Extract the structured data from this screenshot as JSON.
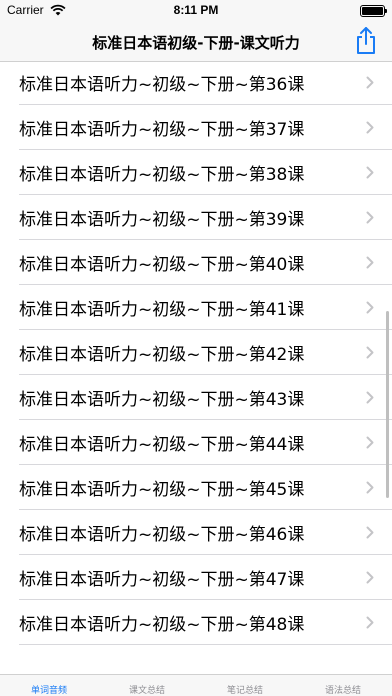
{
  "status_bar": {
    "carrier": "Carrier",
    "time": "8:11 PM",
    "battery_level": 1.0
  },
  "nav": {
    "title": "标准日本语初级-下册-课文听力",
    "share_icon": "share-icon",
    "accent_color": "#1a7cf5"
  },
  "list": {
    "items": [
      {
        "label": "标准日本语听力~初级~下册~第36课"
      },
      {
        "label": "标准日本语听力~初级~下册~第37课"
      },
      {
        "label": "标准日本语听力~初级~下册~第38课"
      },
      {
        "label": "标准日本语听力~初级~下册~第39课"
      },
      {
        "label": "标准日本语听力~初级~下册~第40课"
      },
      {
        "label": "标准日本语听力~初级~下册~第41课"
      },
      {
        "label": "标准日本语听力~初级~下册~第42课"
      },
      {
        "label": "标准日本语听力~初级~下册~第43课"
      },
      {
        "label": "标准日本语听力~初级~下册~第44课"
      },
      {
        "label": "标准日本语听力~初级~下册~第45课"
      },
      {
        "label": "标准日本语听力~初级~下册~第46课"
      },
      {
        "label": "标准日本语听力~初级~下册~第47课"
      },
      {
        "label": "标准日本语听力~初级~下册~第48课"
      }
    ]
  },
  "tabs": [
    {
      "label": "单词音频",
      "active": true
    },
    {
      "label": "课文总结",
      "active": false
    },
    {
      "label": "笔记总结",
      "active": false
    },
    {
      "label": "语法总结",
      "active": false
    }
  ]
}
